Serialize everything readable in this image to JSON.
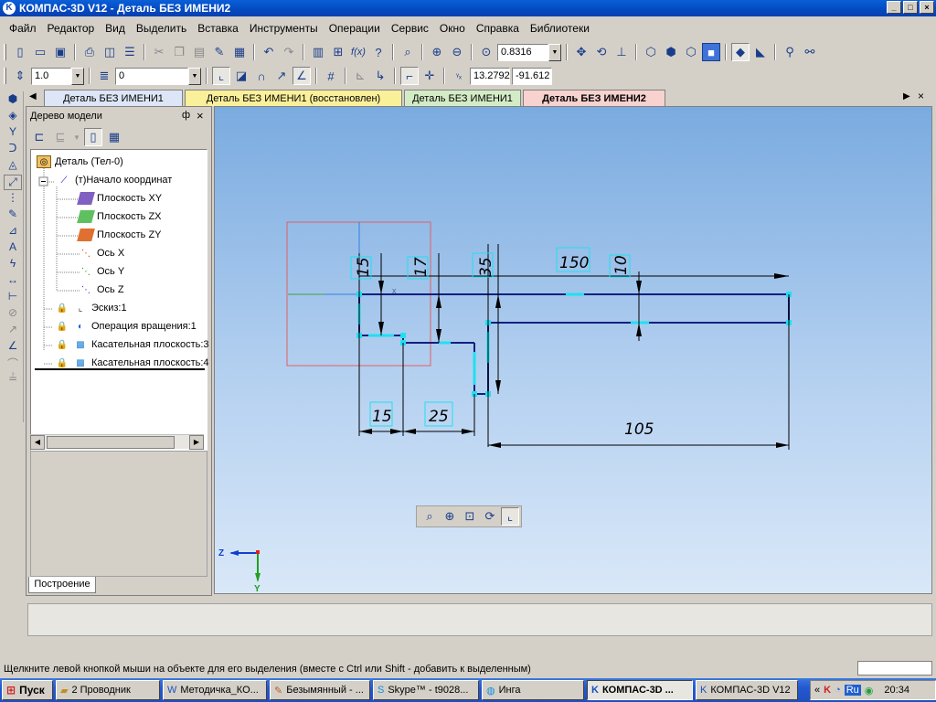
{
  "window": {
    "title": "КОМПАС-3D V12 - Деталь БЕЗ ИМЕНИ2",
    "btn_min": "_",
    "btn_max": "□",
    "btn_close": "×"
  },
  "menu": [
    "Файл",
    "Редактор",
    "Вид",
    "Выделить",
    "Вставка",
    "Инструменты",
    "Операции",
    "Сервис",
    "Окно",
    "Справка",
    "Библиотеки"
  ],
  "toolbar1": {
    "zoom_value": "0.8316"
  },
  "toolbar2": {
    "step_value": "1.0",
    "layer_value": "0",
    "coord_x": "13.2792",
    "coord_y": "-91.612"
  },
  "tabs": [
    {
      "label": "Деталь БЕЗ ИМЕНИ1",
      "color": "#dde6f6"
    },
    {
      "label": "Деталь БЕЗ ИМЕНИ1 (восстановлен)",
      "color": "#fbf09a"
    },
    {
      "label": "Деталь БЕЗ ИМЕНИ1",
      "color": "#d3ecc6"
    },
    {
      "label": "Деталь БЕЗ ИМЕНИ2",
      "color": "#f7d2cf"
    }
  ],
  "tree_panel": {
    "title": "Дерево модели",
    "pin": "ф",
    "close": "×",
    "bottom_tab": "Построение",
    "items": [
      {
        "label": "Деталь (Тел-0)",
        "icon": "part-icon"
      },
      {
        "label": "(т)Начало координат",
        "icon": "origin-icon"
      },
      {
        "label": "Плоскость XY",
        "icon": "plane-xy-icon"
      },
      {
        "label": "Плоскость ZX",
        "icon": "plane-zx-icon"
      },
      {
        "label": "Плоскость ZY",
        "icon": "plane-zy-icon"
      },
      {
        "label": "Ось X",
        "icon": "axis-x-icon"
      },
      {
        "label": "Ось Y",
        "icon": "axis-y-icon"
      },
      {
        "label": "Ось Z",
        "icon": "axis-z-icon"
      },
      {
        "label": "Эскиз:1",
        "icon": "sketch-icon"
      },
      {
        "label": "Операция вращения:1",
        "icon": "revolve-icon"
      },
      {
        "label": "Касательная плоскость:3",
        "icon": "tangent-plane-icon"
      },
      {
        "label": "Касательная плоскость:4",
        "icon": "tangent-plane-icon"
      }
    ]
  },
  "drawing": {
    "dims": [
      "15",
      "17",
      "35",
      "150",
      "10",
      "15",
      "25",
      "105"
    ],
    "axis_x_label": "x",
    "axis_z_label": "Z",
    "axis_y_label": "Y"
  },
  "status_text": "Щелкните левой кнопкой мыши на объекте для его выделения (вместе с Ctrl или Shift - добавить к выделенным)",
  "taskbar": {
    "start": "Пуск",
    "tasks": [
      "2 Проводник",
      "Методичка_КО...",
      "Безымянный - ...",
      "Skype™ - t9028...",
      "Инга",
      "КОМПАС-3D ...",
      "КОМПАС-3D V12"
    ],
    "lang": "Ru",
    "clock": "20:34"
  }
}
